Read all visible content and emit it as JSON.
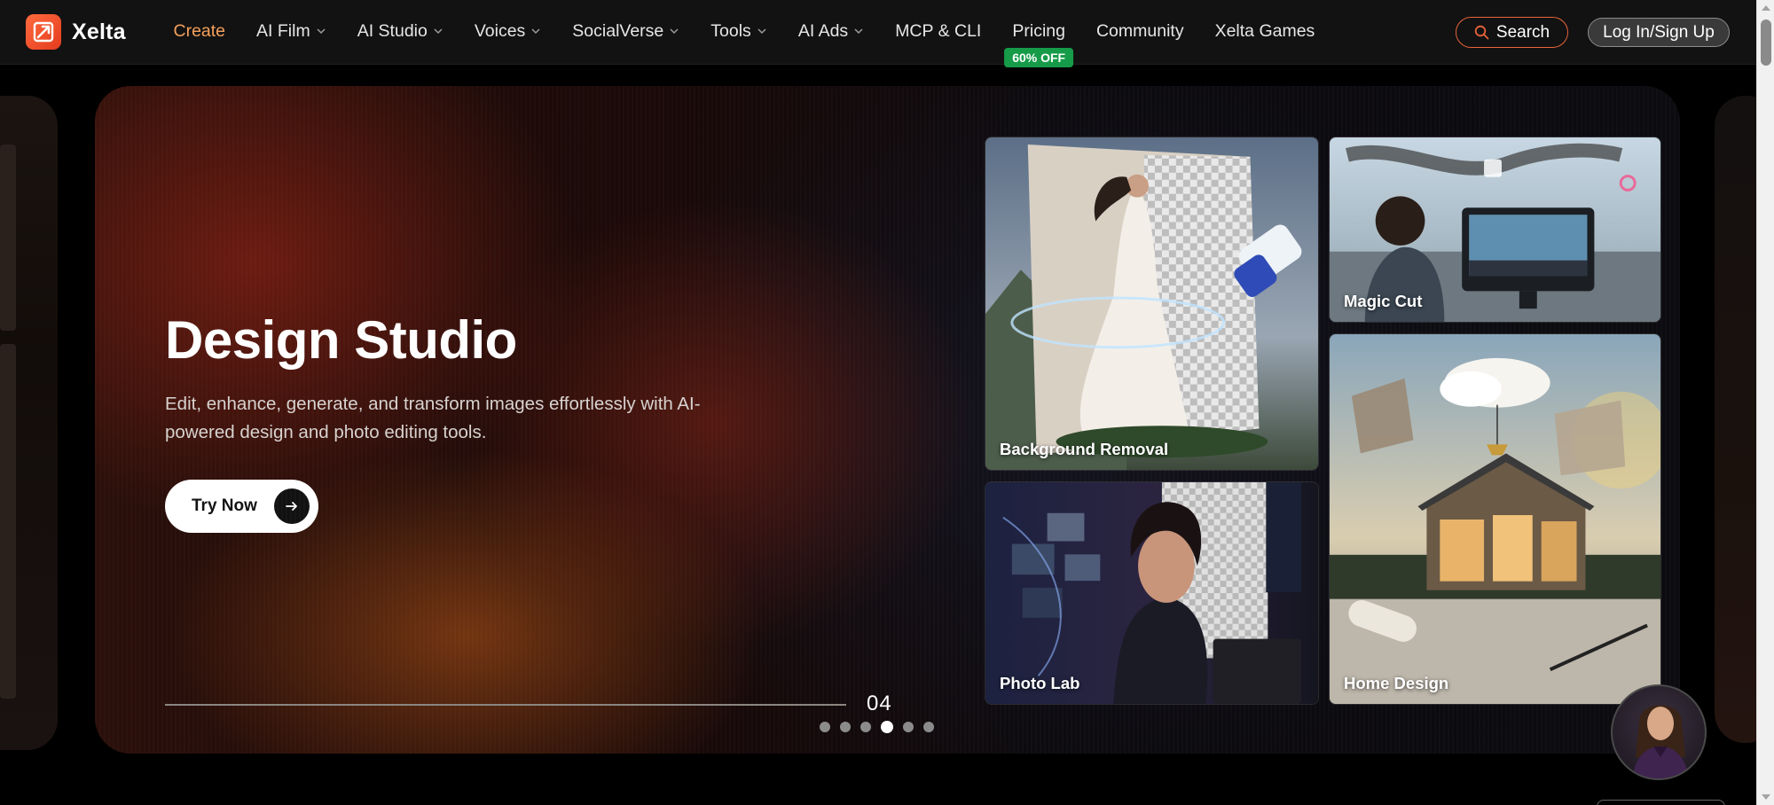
{
  "app": {
    "name": "Xelta"
  },
  "nav": {
    "items": [
      {
        "label": "Create",
        "dropdown": false,
        "active": true
      },
      {
        "label": "AI Film",
        "dropdown": true
      },
      {
        "label": "AI Studio",
        "dropdown": true
      },
      {
        "label": "Voices",
        "dropdown": true
      },
      {
        "label": "SocialVerse",
        "dropdown": true
      },
      {
        "label": "Tools",
        "dropdown": true
      },
      {
        "label": "AI Ads",
        "dropdown": true
      },
      {
        "label": "MCP & CLI",
        "dropdown": false
      },
      {
        "label": "Pricing",
        "dropdown": false,
        "badge": "60% OFF"
      },
      {
        "label": "Community",
        "dropdown": false
      },
      {
        "label": "Xelta Games",
        "dropdown": false
      }
    ],
    "search_label": "Search",
    "login_label": "Log In/Sign Up"
  },
  "hero": {
    "title": "Design Studio",
    "description": "Edit, enhance, generate, and transform images effortlessly with AI-powered design and photo editing tools.",
    "cta_label": "Try Now",
    "slide_number": "04",
    "slide_count": 6,
    "active_slide": 4
  },
  "cards": {
    "background_removal": "Background Removal",
    "magic_cut": "Magic Cut",
    "photo_lab": "Photo Lab",
    "home_design": "Home Design"
  },
  "colors": {
    "accent": "#e8643c",
    "active_nav": "#f5a15c",
    "badge": "#169b49"
  }
}
